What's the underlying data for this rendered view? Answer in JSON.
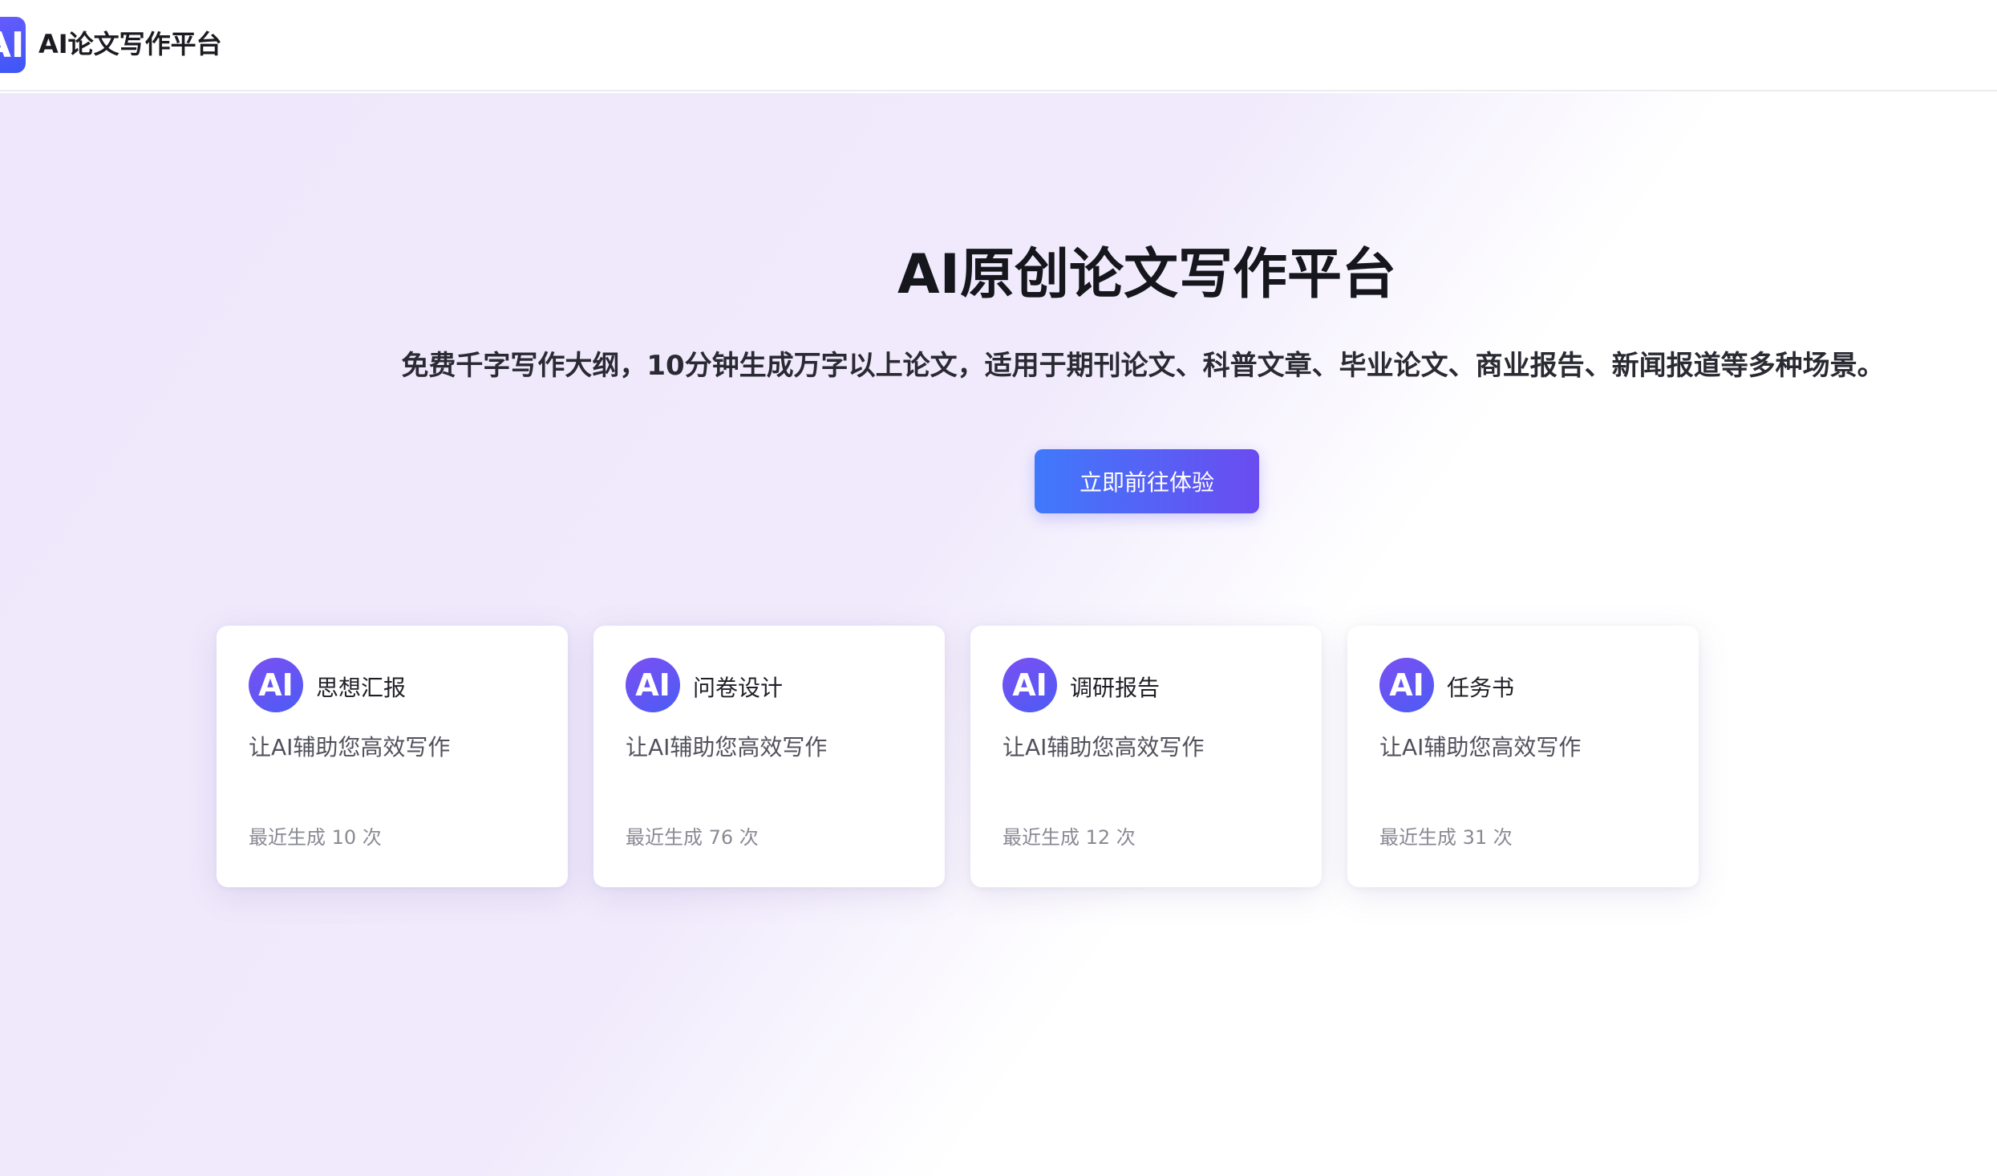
{
  "header": {
    "logo_text": "AI",
    "brand": "AI论文写作平台"
  },
  "hero": {
    "title": "AI原创论文写作平台",
    "subtitle": "免费千字写作大纲，10分钟生成万字以上论文，适用于期刊论文、科普文章、毕业论文、商业报告、新闻报道等多种场景。",
    "cta_label": "立即前往体验"
  },
  "cards": [
    {
      "icon": "AI",
      "title": "思想汇报",
      "desc": "让AI辅助您高效写作",
      "meta": "最近生成 10 次"
    },
    {
      "icon": "AI",
      "title": "问卷设计",
      "desc": "让AI辅助您高效写作",
      "meta": "最近生成 76 次"
    },
    {
      "icon": "AI",
      "title": "调研报告",
      "desc": "让AI辅助您高效写作",
      "meta": "最近生成 12 次"
    },
    {
      "icon": "AI",
      "title": "任务书",
      "desc": "让AI辅助您高效写作",
      "meta": "最近生成 31 次"
    }
  ],
  "colors": {
    "accent_start": "#4079fb",
    "accent_end": "#6a4cf0",
    "background_tint": "#efe8fc"
  }
}
